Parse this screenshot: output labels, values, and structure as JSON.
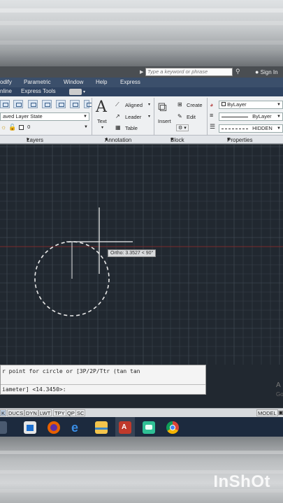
{
  "search": {
    "placeholder": "Type a keyword or phrase",
    "sign_in": "Sign In"
  },
  "menu": [
    "odify",
    "Parametric",
    "Window",
    "Help",
    "Express"
  ],
  "ribbon_tabs": [
    "nline",
    "Express Tools"
  ],
  "layers": {
    "layer_state": "aved Layer State",
    "current_layer": "0",
    "panel_label": "Layers"
  },
  "annotation": {
    "text_label": "Text",
    "aligned": "Aligned",
    "leader": "Leader",
    "table": "Table",
    "panel_label": "Annotation"
  },
  "block": {
    "insert": "Insert",
    "create": "Create",
    "edit": "Edit",
    "panel_label": "Block"
  },
  "properties": {
    "color": "ByLayer",
    "lineweight": "ByLayer",
    "linetype": "HIDDEN",
    "panel_label": "Properties"
  },
  "drawing": {
    "ortho_tooltip": "Ortho: 3.3527 < 90°",
    "background_color": "#212830",
    "grid_color": "#3a424c",
    "circle_color": "#e8e8e8",
    "axis_color": "#7a2a2a"
  },
  "command": {
    "prompt_line": "r point for circle or [3P/2P/Ttr (tan tan",
    "input_line": "iameter] <14.3450>:"
  },
  "watermark_side": {
    "line1": "A",
    "line2": "Go"
  },
  "status": {
    "toggles": [
      "K",
      "DUCS",
      "DYN",
      "LWT",
      "TPY",
      "QP",
      "SC"
    ],
    "model": "MODEL"
  },
  "taskbar": {
    "icons": [
      "store-icon",
      "firefox-icon",
      "edge-icon",
      "file-explorer-icon",
      "autocad-icon",
      "android-app-icon",
      "chrome-icon"
    ]
  },
  "brand_watermark": "InShOt"
}
